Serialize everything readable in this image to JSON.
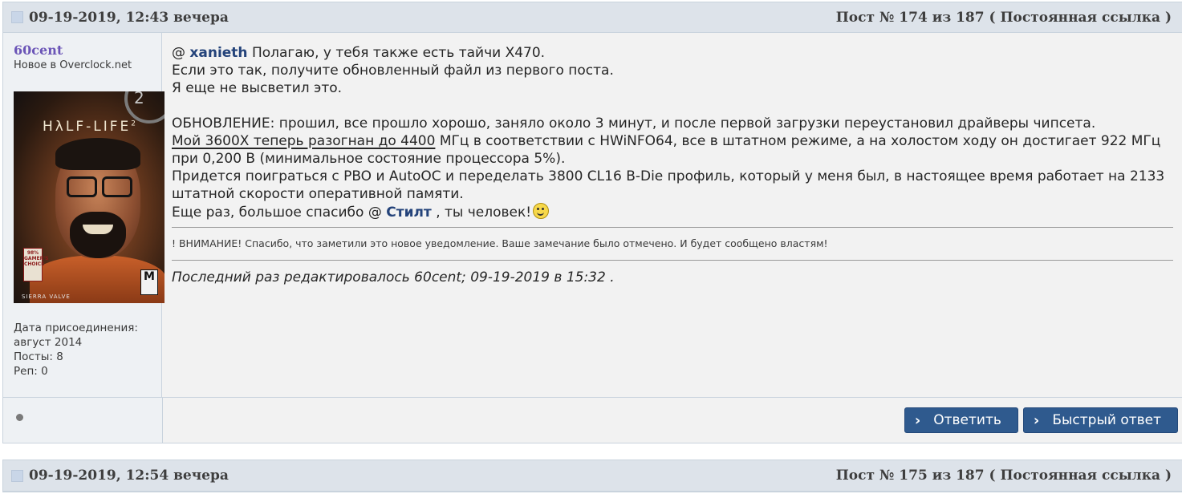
{
  "posts": [
    {
      "date": "09-19-2019, 12:43 вечера",
      "post_label": "Пост № 174 из 187",
      "permalink": "( Постоянная ссылка )",
      "user": {
        "name": "60cent",
        "title": "Новое в Overclock.net",
        "avatar_text": "HλLF-LIFE",
        "avatar_sup": "2",
        "avatar_badge": "98% GAMER'S CHOICE",
        "avatar_rating": "M",
        "avatar_footer": "SIERRA   VALVE",
        "join_label": "Дата присоединения:",
        "join_date": "август 2014",
        "posts_label": "Посты: 8",
        "rep_label": "Реп: 0"
      },
      "content": {
        "line1_prefix": "@",
        "line1_mention": "xanieth",
        "line1_rest": "Полагаю, у тебя также есть тайчи X470.",
        "line2": "Если это так, получите обновленный файл из первого поста.",
        "line3": "Я еще не высветил это.",
        "line4": "ОБНОВЛЕНИЕ: прошил, все прошло хорошо, заняло около 3 минут, и после первой загрузки переустановил драйверы чипсета.",
        "line5_underlined": "Мой 3600X теперь разогнан до 4400",
        "line5_rest": " МГц в соответствии с HWiNFO64, все в штатном режиме, а на холостом ходу он достигает 922 МГц при 0,200 В (минимальное состояние процессора 5%).",
        "line6": "Придется поиграться с PBO и AutoOC и переделать 3800 CL16 B-Die профиль, который у меня был, в настоящее время работает на 2133 штатной скорости оперативной памяти.",
        "line7_prefix": "Еще раз, большое спасибо @",
        "line7_mention": "Стилт",
        "line7_rest": ", ты человек!"
      },
      "notice": "! ВНИМАНИЕ! Спасибо, что заметили это новое уведомление. Ваше замечание было отмечено. И будет сообщено властям!",
      "last_edit": "Последний раз редактировалось 60cent; 09-19-2019 в 15:32 .",
      "buttons": {
        "reply": "Ответить",
        "quick_reply": "Быстрый ответ"
      }
    },
    {
      "date": "09-19-2019, 12:54 вечера",
      "post_label": "Пост № 175 из 187",
      "permalink": "( Постоянная ссылка )"
    }
  ],
  "colors": {
    "header_bg": "#dde3ea",
    "username": "#6b55b7",
    "mention": "#24437a",
    "button": "#2f5a8e"
  }
}
